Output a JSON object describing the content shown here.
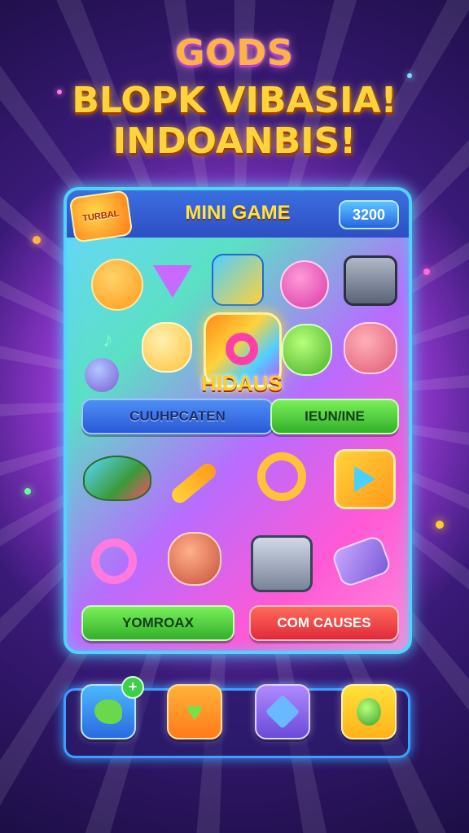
{
  "header": {
    "logo_text": "GODS",
    "headline_line1": "BLOPK VIBASIA!",
    "headline_line2": "INDOANBIS!"
  },
  "panel": {
    "badge_text": "TURBAL",
    "title": "MINI GAME",
    "score": "3200",
    "center_label": "HIDAUS",
    "buttons": {
      "left_top": "CUUHPCATEN",
      "right_top": "IEUN/INE",
      "left_bottom": "YOMROAX",
      "right_bottom": "COM CAUSES"
    }
  },
  "colors": {
    "accent_cyan": "#4fd4ff",
    "title_yellow": "#ffd43a",
    "green_button": "#33b02a",
    "red_button": "#e02a3a",
    "blue_button": "#2a59d8"
  },
  "nav": {
    "items": [
      {
        "icon": "bird-icon",
        "has_plus": true
      },
      {
        "icon": "heart-icon",
        "has_plus": false
      },
      {
        "icon": "pencil-icon",
        "has_plus": false
      },
      {
        "icon": "gem-icon",
        "has_plus": false
      }
    ],
    "plus_label": "+"
  }
}
